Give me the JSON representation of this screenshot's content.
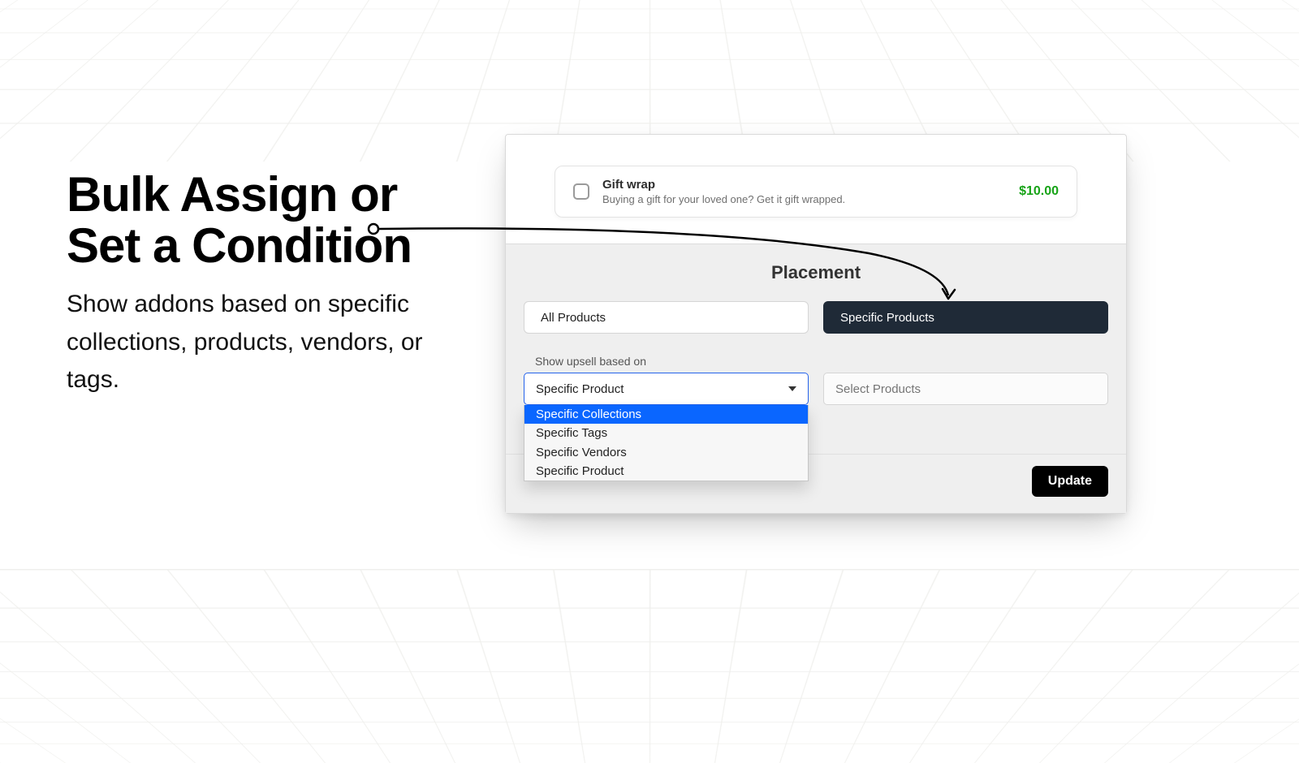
{
  "marketing": {
    "headline": "Bulk Assign or Set a Condition",
    "subline": "Show addons based on specific collections, products, vendors, or tags."
  },
  "addon": {
    "title": "Gift wrap",
    "description": "Buying a gift for your loved one? Get it gift wrapped.",
    "price": "$10.00"
  },
  "placement": {
    "heading": "Placement",
    "tab_all": "All Products",
    "tab_specific": "Specific Products",
    "field_label": "Show upsell based on",
    "select_value": "Specific Product",
    "options": [
      "Specific Collections",
      "Specific Tags",
      "Specific Vendors",
      "Specific Product"
    ],
    "products_placeholder": "Select Products",
    "update_label": "Update"
  },
  "colors": {
    "accent_green": "#17a317",
    "accent_dark": "#1f2a37",
    "highlight_blue": "#0a66ff"
  }
}
